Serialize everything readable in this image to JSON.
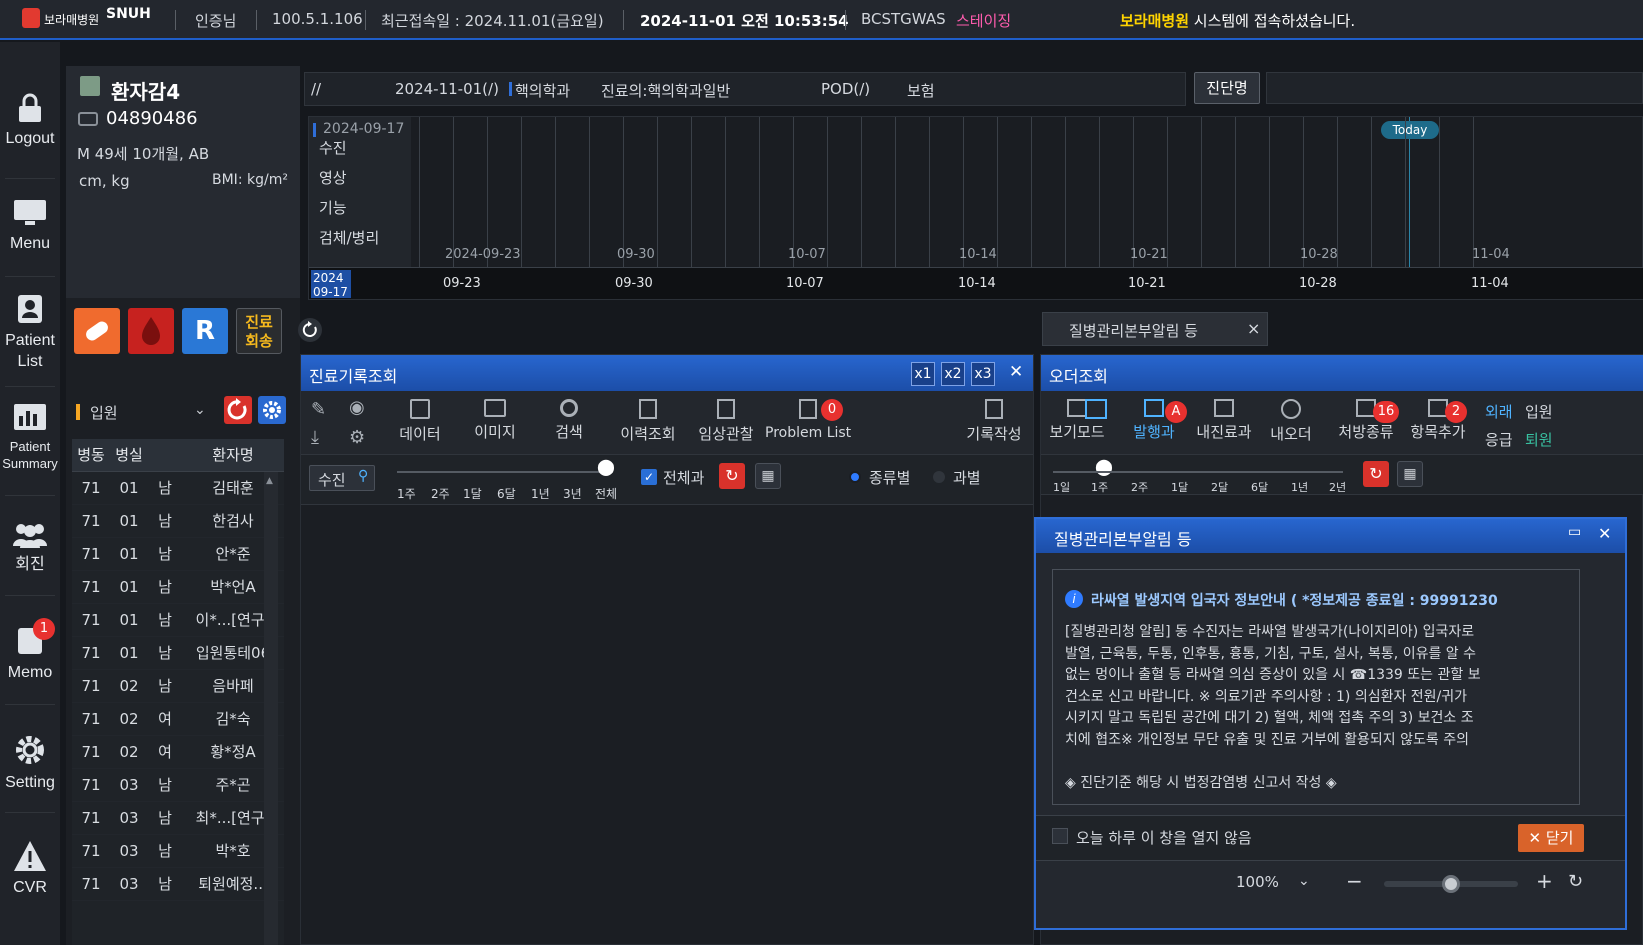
{
  "topbar": {
    "hospital_logo": "보라매병원",
    "snuh_logo": "SNUH",
    "user": "인증님",
    "ip": "100.5.1.106",
    "last_access": "최근접속일 : 2024.11.01(금요일)",
    "datetime": "2024-11-01 오전 10:53:54",
    "system_id": "BCSTGWAS",
    "env": "스테이징",
    "welcome_hospital": "보라매병원",
    "welcome_rest": " 시스템에 접속하셨습니다."
  },
  "nav": {
    "logout": "Logout",
    "menu": "Menu",
    "patient_list": [
      "Patient",
      "List"
    ],
    "patient_summary": [
      "Patient",
      "Summary"
    ],
    "rounds": "회진",
    "memo": "Memo",
    "memo_badge": "1",
    "setting": "Setting",
    "cvr": "CVR"
  },
  "patient": {
    "name": "환자감4",
    "id": "04890486",
    "demo": "M 49세 10개월,   AB",
    "units": "cm, kg",
    "bmi": "BMI: kg/m²",
    "reply_btn": [
      "진료",
      "회송"
    ],
    "r_btn": "R",
    "ward_select": "입원",
    "list_headers": [
      "병동",
      "병실",
      "",
      "환자명"
    ],
    "rows": [
      [
        "71",
        "01",
        "남",
        "김태훈"
      ],
      [
        "71",
        "01",
        "남",
        "한검사"
      ],
      [
        "71",
        "01",
        "남",
        "안*준"
      ],
      [
        "71",
        "01",
        "남",
        "박*언A"
      ],
      [
        "71",
        "01",
        "남",
        "이*...[연구]"
      ],
      [
        "71",
        "01",
        "남",
        "입원통테06"
      ],
      [
        "71",
        "02",
        "남",
        "음바페"
      ],
      [
        "71",
        "02",
        "여",
        "김*숙"
      ],
      [
        "71",
        "02",
        "여",
        "황*정A"
      ],
      [
        "71",
        "03",
        "남",
        "주*곤"
      ],
      [
        "71",
        "03",
        "남",
        "최*...[연구]"
      ],
      [
        "71",
        "03",
        "남",
        "박*호"
      ],
      [
        "71",
        "03",
        "남",
        "퇴원예정..."
      ]
    ]
  },
  "infobar": {
    "slashes": "//",
    "date": "2024-11-01(/)",
    "dept": "핵의학과",
    "doctor": "진료의:핵의학과일반",
    "pod": "POD(/)",
    "insurance": "보험",
    "diag_btn": "진단명"
  },
  "timeline": {
    "start_date": "2024-09-17",
    "categories": [
      "수진",
      "영상",
      "기능",
      "검체/병리"
    ],
    "upper_dates": [
      "2024-09-23",
      "09-30",
      "10-07",
      "10-14",
      "10-21",
      "10-28",
      "11-04"
    ],
    "lower_dates": [
      "09-23",
      "09-30",
      "10-07",
      "10-14",
      "10-21",
      "10-28",
      "11-04"
    ],
    "scroll_year": "2024",
    "scroll_md": "09-17",
    "today": "Today"
  },
  "floating_tab": {
    "label": "질병관리본부알림 등",
    "close": "×"
  },
  "records_panel": {
    "title": "진료기록조회",
    "x1": "x1",
    "x2": "x2",
    "x3": "x3",
    "tools": [
      "데이터",
      "이미지",
      "검색",
      "이력조회",
      "임상관찰",
      "Problem List",
      "기록작성"
    ],
    "problem_badge": "0",
    "filter": "수진",
    "ranges": [
      "1주",
      "2주",
      "1달",
      "6달",
      "1년",
      "3년",
      "전체"
    ],
    "all_dept": "전체과",
    "by_type": "종류별",
    "by_dept": "과별"
  },
  "order_panel": {
    "title": "오더조회",
    "tools": [
      "보기모드",
      "발행과",
      "내진료과",
      "내오더",
      "처방종류",
      "항목추가"
    ],
    "badge_a": "A",
    "badge_16": "16",
    "badge_2": "2",
    "outpatient": "외래",
    "inpatient": "입원",
    "emergency": "응급",
    "discharge": "퇴원",
    "ranges": [
      "1일",
      "1주",
      "2주",
      "1달",
      "2달",
      "6달",
      "1년",
      "2년"
    ]
  },
  "popup": {
    "title": "질병관리본부알림 등",
    "heading": "라싸열 발생지역 입국자 정보안내 ( *정보제공 종료일 : 99991230",
    "body_lines": [
      "[질병관리청 알림] 동 수진자는 라싸열 발생국가(나이지리아) 입국자로",
      "발열, 근육통, 두통, 인후통, 흉통, 기침, 구토, 설사, 복통, 이유를 알 수",
      "없는 멍이나 출혈 등 라싸열 의심 증상이 있을 시 ☎1339 또는 관할 보",
      "건소로 신고 바랍니다. ※ 의료기관 주의사항 : 1) 의심환자 전원/귀가",
      "시키지 말고 독립된 공간에 대기 2) 혈액, 체액 접촉 주의 3) 보건소 조",
      "치에 협조※ 개인정보 무단 유출 및 진료 거부에 활용되지 않도록 주의"
    ],
    "footer_note": "◈ 진단기준 해당 시 법정감염병 신고서 작성 ◈",
    "dont_show": "오늘 하루 이 창을 열지 않음",
    "close_btn": "닫기",
    "zoom": "100%",
    "zoom_fraction": 0.5
  },
  "colors": {
    "accent": "#2866cf",
    "staging": "#ff5cae",
    "welcome": "#ffd400",
    "red": "#e23a30"
  }
}
